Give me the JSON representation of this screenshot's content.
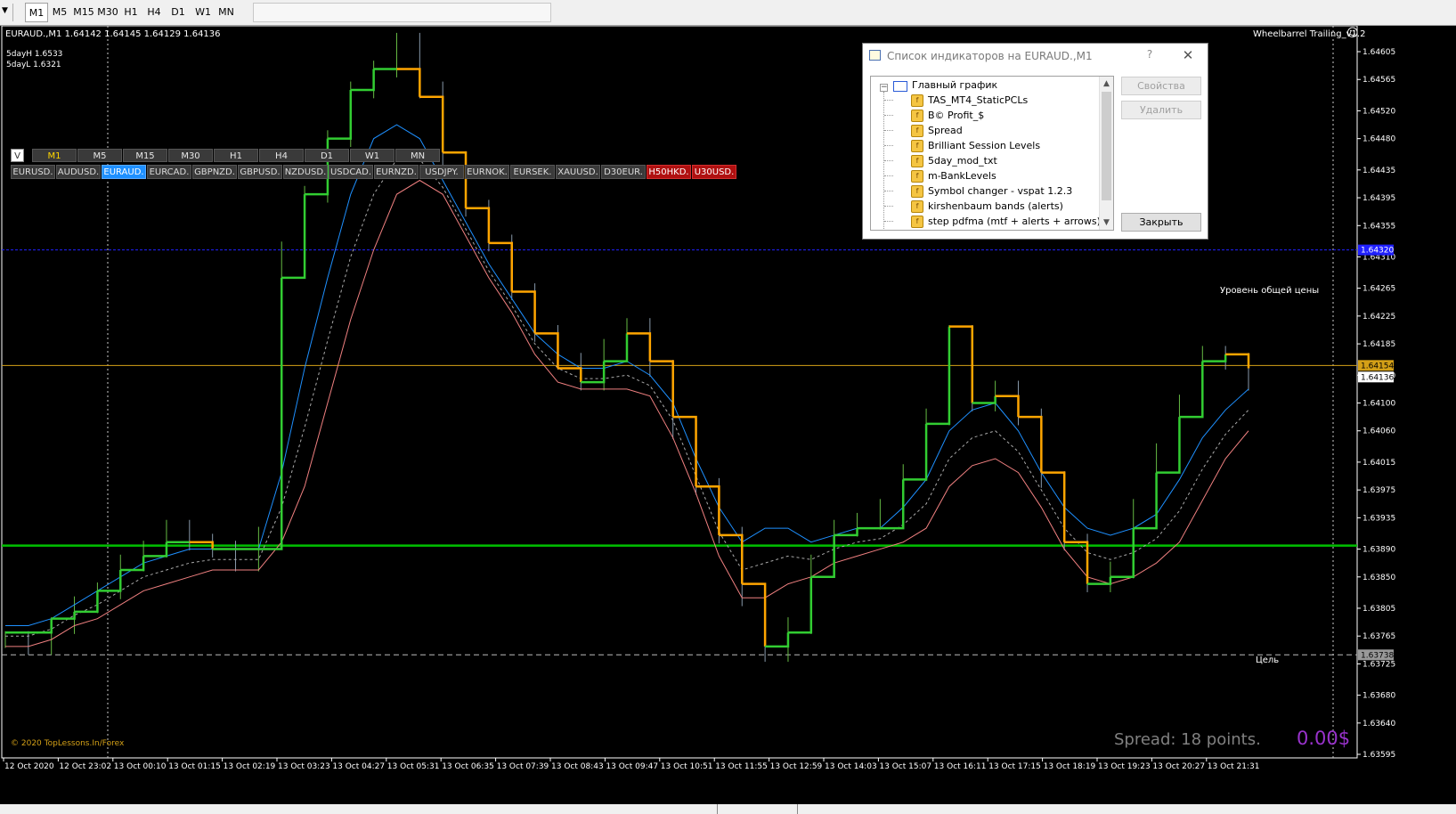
{
  "toolbar": {
    "timeframes": [
      "M1",
      "M5",
      "M15",
      "M30",
      "H1",
      "H4",
      "D1",
      "W1",
      "MN"
    ],
    "active": "M1"
  },
  "chart": {
    "header": "EURAUD.,M1  1.64142 1.64145 1.64129 1.64136",
    "day_high": "5dayH 1.6533",
    "day_low": "5dayL 1.6321",
    "ea_name": "Wheelbarrel Trailing_v1.2",
    "smiley": "☺",
    "copyright": "© 2020 TopLessons.In/Forex",
    "spread": "Spread: 18 points.",
    "profit": "0.00$",
    "price_level_label": "Уровень общей цены",
    "target_label": "Цель",
    "colors": {
      "background": "#000000",
      "bull_bar": "#66bb44",
      "bear_bar": "#8899aa",
      "step_up": "#32cd32",
      "step_down": "#ffa500",
      "band_fast": "#1e90ff",
      "band_slow": "#f08080",
      "band_mid": "#aaaaaa",
      "level_blue": "#2020ff",
      "level_yellow": "#d4a017",
      "level_green": "#00c000",
      "target_line": "#bbbbbb",
      "profit_text": "#9932cc",
      "spread_text": "#808080"
    },
    "price_labels": {
      "blue": "1.64320",
      "yellow": "1.64154",
      "current": "1.64136",
      "target": "1.63738"
    }
  },
  "chart_data": {
    "type": "line",
    "title": "EURAUD.,M1",
    "x_labels": [
      "12 Oct 2020",
      "12 Oct 23:02",
      "13 Oct 00:10",
      "13 Oct 01:15",
      "13 Oct 02:19",
      "13 Oct 03:23",
      "13 Oct 04:27",
      "13 Oct 05:31",
      "13 Oct 06:35",
      "13 Oct 07:39",
      "13 Oct 08:43",
      "13 Oct 09:47",
      "13 Oct 10:51",
      "13 Oct 11:55",
      "13 Oct 12:59",
      "13 Oct 14:03",
      "13 Oct 15:07",
      "13 Oct 16:11",
      "13 Oct 17:15",
      "13 Oct 18:19",
      "13 Oct 19:23",
      "13 Oct 20:27",
      "13 Oct 21:31"
    ],
    "y_ticks": [
      "1.64605",
      "1.64565",
      "1.64520",
      "1.64480",
      "1.64435",
      "1.64395",
      "1.64355",
      "1.64310",
      "1.64265",
      "1.64225",
      "1.64185",
      "1.64140",
      "1.64100",
      "1.64060",
      "1.64015",
      "1.63975",
      "1.63935",
      "1.63890",
      "1.63850",
      "1.63805",
      "1.63765",
      "1.63725",
      "1.63680",
      "1.63640",
      "1.63595"
    ],
    "ylim": [
      1.63595,
      1.64605
    ],
    "series": [
      {
        "name": "price",
        "values": [
          1.6376,
          1.6375,
          1.6378,
          1.6381,
          1.6383,
          1.6387,
          1.6389,
          1.6392,
          1.639,
          1.6389,
          1.6387,
          1.6391,
          1.6432,
          1.644,
          1.6448,
          1.6455,
          1.6458,
          1.6462,
          1.6455,
          1.6445,
          1.6438,
          1.6433,
          1.6426,
          1.642,
          1.6416,
          1.6413,
          1.6418,
          1.6421,
          1.6415,
          1.6406,
          1.6398,
          1.6391,
          1.6382,
          1.6374,
          1.6378,
          1.6387,
          1.6392,
          1.6393,
          1.6395,
          1.64,
          1.6408,
          1.642,
          1.641,
          1.6412,
          1.6408,
          1.6399,
          1.639,
          1.6384,
          1.6386,
          1.6395,
          1.6403,
          1.641,
          1.6417,
          1.6416,
          1.6413
        ]
      },
      {
        "name": "step_ma",
        "values": [
          1.6377,
          1.6377,
          1.6379,
          1.638,
          1.6383,
          1.6386,
          1.6388,
          1.639,
          1.639,
          1.6389,
          1.6389,
          1.6389,
          1.6428,
          1.644,
          1.6448,
          1.6455,
          1.6458,
          1.6458,
          1.6454,
          1.6446,
          1.6438,
          1.6433,
          1.6426,
          1.642,
          1.6415,
          1.6413,
          1.6416,
          1.642,
          1.6416,
          1.6408,
          1.6398,
          1.6391,
          1.6384,
          1.6375,
          1.6377,
          1.6385,
          1.6391,
          1.6392,
          1.6392,
          1.6399,
          1.6407,
          1.6421,
          1.641,
          1.6411,
          1.6408,
          1.64,
          1.639,
          1.6384,
          1.6385,
          1.6392,
          1.64,
          1.6408,
          1.6416,
          1.6417,
          1.6415
        ]
      },
      {
        "name": "band_fast",
        "values": [
          1.6378,
          1.6378,
          1.6379,
          1.6381,
          1.6383,
          1.6385,
          1.6387,
          1.6388,
          1.6389,
          1.6389,
          1.6389,
          1.6389,
          1.64,
          1.6415,
          1.6428,
          1.644,
          1.6448,
          1.645,
          1.6448,
          1.6442,
          1.6436,
          1.643,
          1.6425,
          1.642,
          1.6417,
          1.6415,
          1.6415,
          1.6416,
          1.6414,
          1.641,
          1.6402,
          1.6395,
          1.639,
          1.6392,
          1.6392,
          1.639,
          1.6391,
          1.6392,
          1.6392,
          1.6395,
          1.6399,
          1.6406,
          1.6409,
          1.641,
          1.6406,
          1.64,
          1.6395,
          1.6392,
          1.6391,
          1.6392,
          1.6394,
          1.6399,
          1.6405,
          1.6409,
          1.6412
        ]
      },
      {
        "name": "band_slow",
        "values": [
          1.6375,
          1.6375,
          1.6376,
          1.6378,
          1.6379,
          1.6381,
          1.6383,
          1.6384,
          1.6385,
          1.6386,
          1.6386,
          1.6386,
          1.639,
          1.6398,
          1.641,
          1.6422,
          1.6432,
          1.644,
          1.6442,
          1.644,
          1.6434,
          1.6428,
          1.6423,
          1.6417,
          1.6413,
          1.6412,
          1.6412,
          1.6412,
          1.6411,
          1.6405,
          1.6397,
          1.6388,
          1.6382,
          1.6382,
          1.6384,
          1.6385,
          1.6387,
          1.6388,
          1.6389,
          1.639,
          1.6392,
          1.6398,
          1.6401,
          1.6402,
          1.64,
          1.6395,
          1.6389,
          1.6385,
          1.6384,
          1.6385,
          1.6387,
          1.639,
          1.6396,
          1.6402,
          1.6406
        ]
      }
    ],
    "levels": [
      {
        "name": "blue",
        "value": 1.6432
      },
      {
        "name": "yellow",
        "value": 1.64154
      },
      {
        "name": "green",
        "value": 1.63895
      },
      {
        "name": "target",
        "value": 1.63738
      }
    ]
  },
  "symbol_changer": {
    "v_label": "V",
    "timeframes": [
      "M1",
      "M5",
      "M15",
      "M30",
      "H1",
      "H4",
      "D1",
      "W1",
      "MN"
    ],
    "active_timeframe": "M1",
    "symbols": [
      "EURUSD.",
      "AUDUSD.",
      "EURAUD.",
      "EURCAD.",
      "GBPNZD.",
      "GBPUSD.",
      "NZDUSD.",
      "USDCAD.",
      "EURNZD.",
      "USDJPY.",
      "EURNOK.",
      "EURSEK.",
      "XAUUSD.",
      "D30EUR.",
      "H50HKD.",
      "U30USD."
    ],
    "active_symbol": "EURAUD.",
    "red_symbols": [
      "H50HKD.",
      "U30USD."
    ]
  },
  "dialog": {
    "title": "Список индикаторов на EURAUD.,M1",
    "help": "?",
    "close": "✕",
    "root_label": "Главный график",
    "indicators": [
      "TAS_MT4_StaticPCLs",
      "B© Profit_$",
      "Spread",
      "Brilliant Session Levels",
      "5day_mod_txt",
      "m-BankLevels",
      "Symbol changer - vspat 1.2.3",
      "kirshenbaum bands (alerts)",
      "step pdfma (mtf + alerts + arrows)"
    ],
    "buttons": {
      "properties": "Свойства",
      "delete": "Удалить",
      "close": "Закрыть"
    }
  }
}
